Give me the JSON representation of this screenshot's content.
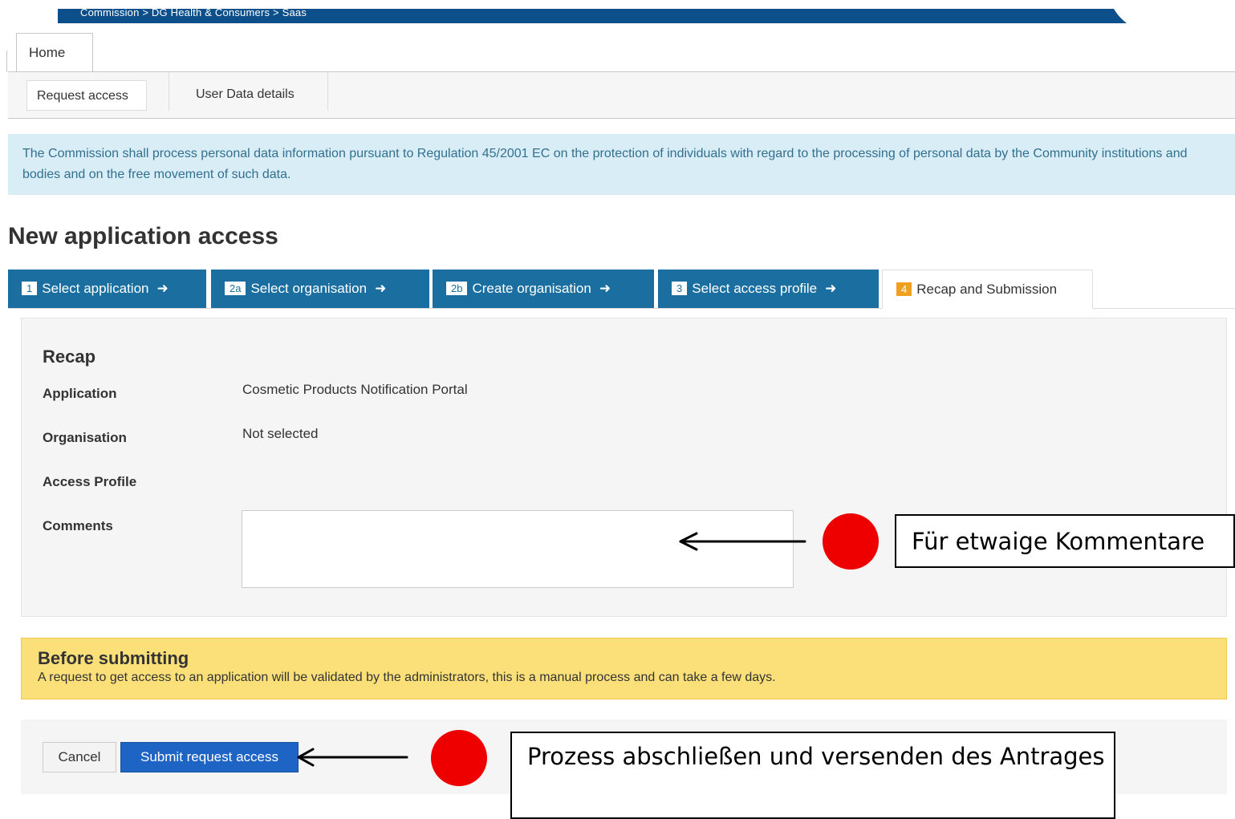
{
  "header": {
    "breadcrumb": "Commission > DG Health & Consumers > Saas",
    "home_tab": "Home"
  },
  "subnav": {
    "items": [
      "Request access",
      "User Data details"
    ]
  },
  "notice": {
    "text": "The Commission shall process personal data information pursuant to Regulation 45/2001 EC on the protection of individuals with regard to the processing of personal data by the Community institutions and bodies and on the free movement of such data."
  },
  "page": {
    "title": "New application access"
  },
  "steps": [
    {
      "num": "1",
      "label": "Select application",
      "arrow": "➜"
    },
    {
      "num": "2a",
      "label": "Select organisation",
      "arrow": "➜"
    },
    {
      "num": "2b",
      "label": "Create organisation",
      "arrow": "➜"
    },
    {
      "num": "3",
      "label": "Select access profile",
      "arrow": "➜"
    },
    {
      "num": "4",
      "label": "Recap and Submission"
    }
  ],
  "recap": {
    "heading": "Recap",
    "application_label": "Application",
    "application_value": "Cosmetic Products Notification Portal",
    "organisation_label": "Organisation",
    "organisation_value": "Not selected",
    "access_profile_label": "Access Profile",
    "access_profile_value": "",
    "comments_label": "Comments",
    "comments_value": ""
  },
  "warning": {
    "title": "Before submitting",
    "text": "A request to get access to an application will be validated by the administrators, this is a manual process and can take a few days."
  },
  "actions": {
    "cancel_label": "Cancel",
    "submit_label": "Submit request access"
  },
  "annotations": {
    "comments_callout": "Für etwaige Kommentare",
    "submit_callout": "Prozess abschließen und versenden des Antrages",
    "marker_color": "#ee0000"
  },
  "colors": {
    "brand_blue": "#0d4f8b",
    "step_blue": "#1b6fa0",
    "submit_blue": "#1d64c4",
    "current_step_badge": "#f0a020",
    "notice_bg": "#d9edf7",
    "warning_bg": "#fbe07a"
  }
}
